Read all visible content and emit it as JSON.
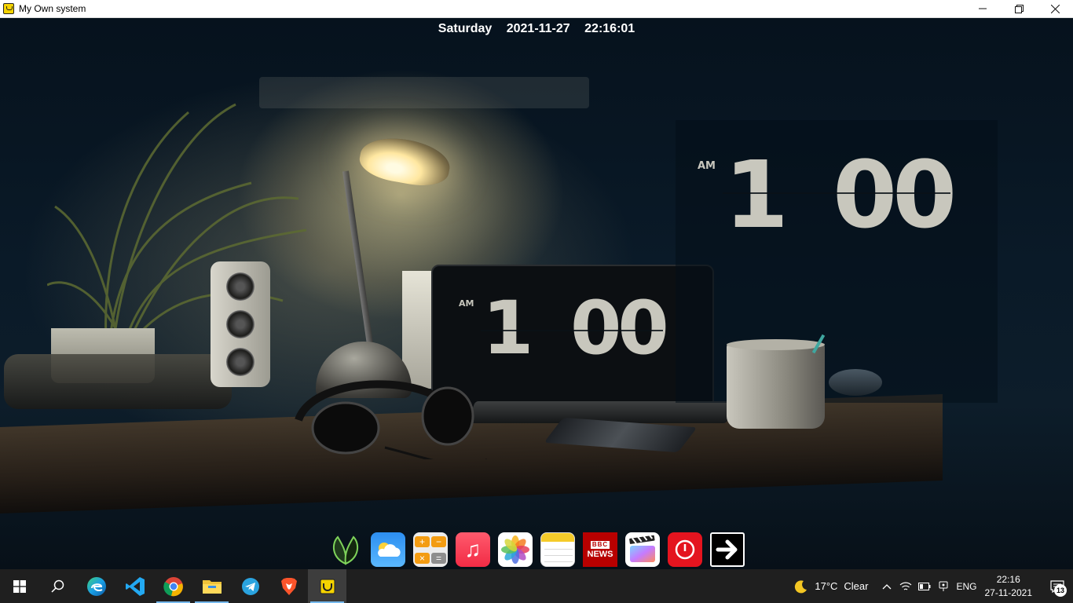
{
  "window": {
    "title": "My Own system",
    "minimize_icon": "minimize-icon",
    "maximize_icon": "restore-icon",
    "close_icon": "close-icon"
  },
  "datetime": {
    "day": "Saturday",
    "date": "2021-11-27",
    "time": "22:16:01"
  },
  "wallpaper_clocks": [
    {
      "ampm": "AM",
      "hour": "1",
      "minutes": "00"
    },
    {
      "ampm": "AM",
      "hour": "1",
      "minutes": "00"
    }
  ],
  "dock": {
    "items": [
      {
        "name": "leaf-app",
        "icon": "leaf-icon"
      },
      {
        "name": "weather-app",
        "icon": "cloud-icon"
      },
      {
        "name": "calculator-app",
        "icon": "calculator-icon"
      },
      {
        "name": "music-app",
        "icon": "music-note-icon"
      },
      {
        "name": "photos-app",
        "icon": "photos-flower-icon"
      },
      {
        "name": "notes-app",
        "icon": "notes-icon"
      },
      {
        "name": "news-app",
        "icon": "bbc-news-icon",
        "label_top": "BBC",
        "label_bottom": "NEWS"
      },
      {
        "name": "video-app",
        "icon": "clapperboard-icon"
      },
      {
        "name": "power-app",
        "icon": "power-icon"
      },
      {
        "name": "next-app",
        "icon": "arrow-right-icon"
      }
    ],
    "colors": {
      "power": "#e4141f",
      "news": "#b80000",
      "music": "#f22b45",
      "weather": "#2c8ef0",
      "notes": "#f5cb2a"
    }
  },
  "taskbar": {
    "apps": [
      {
        "name": "start",
        "icon": "windows-icon"
      },
      {
        "name": "search",
        "icon": "search-icon"
      },
      {
        "name": "edge",
        "icon": "edge-icon"
      },
      {
        "name": "vscode",
        "icon": "vscode-icon"
      },
      {
        "name": "chrome",
        "icon": "chrome-icon"
      },
      {
        "name": "file-explorer",
        "icon": "folder-icon"
      },
      {
        "name": "telegram",
        "icon": "telegram-icon"
      },
      {
        "name": "brave",
        "icon": "brave-icon"
      },
      {
        "name": "my-own-system",
        "icon": "app-icon"
      }
    ],
    "tray": {
      "weather_temp": "17°C",
      "weather_text": "Clear",
      "language": "ENG",
      "time": "22:16",
      "date": "27-11-2021",
      "notification_count": "13"
    }
  }
}
